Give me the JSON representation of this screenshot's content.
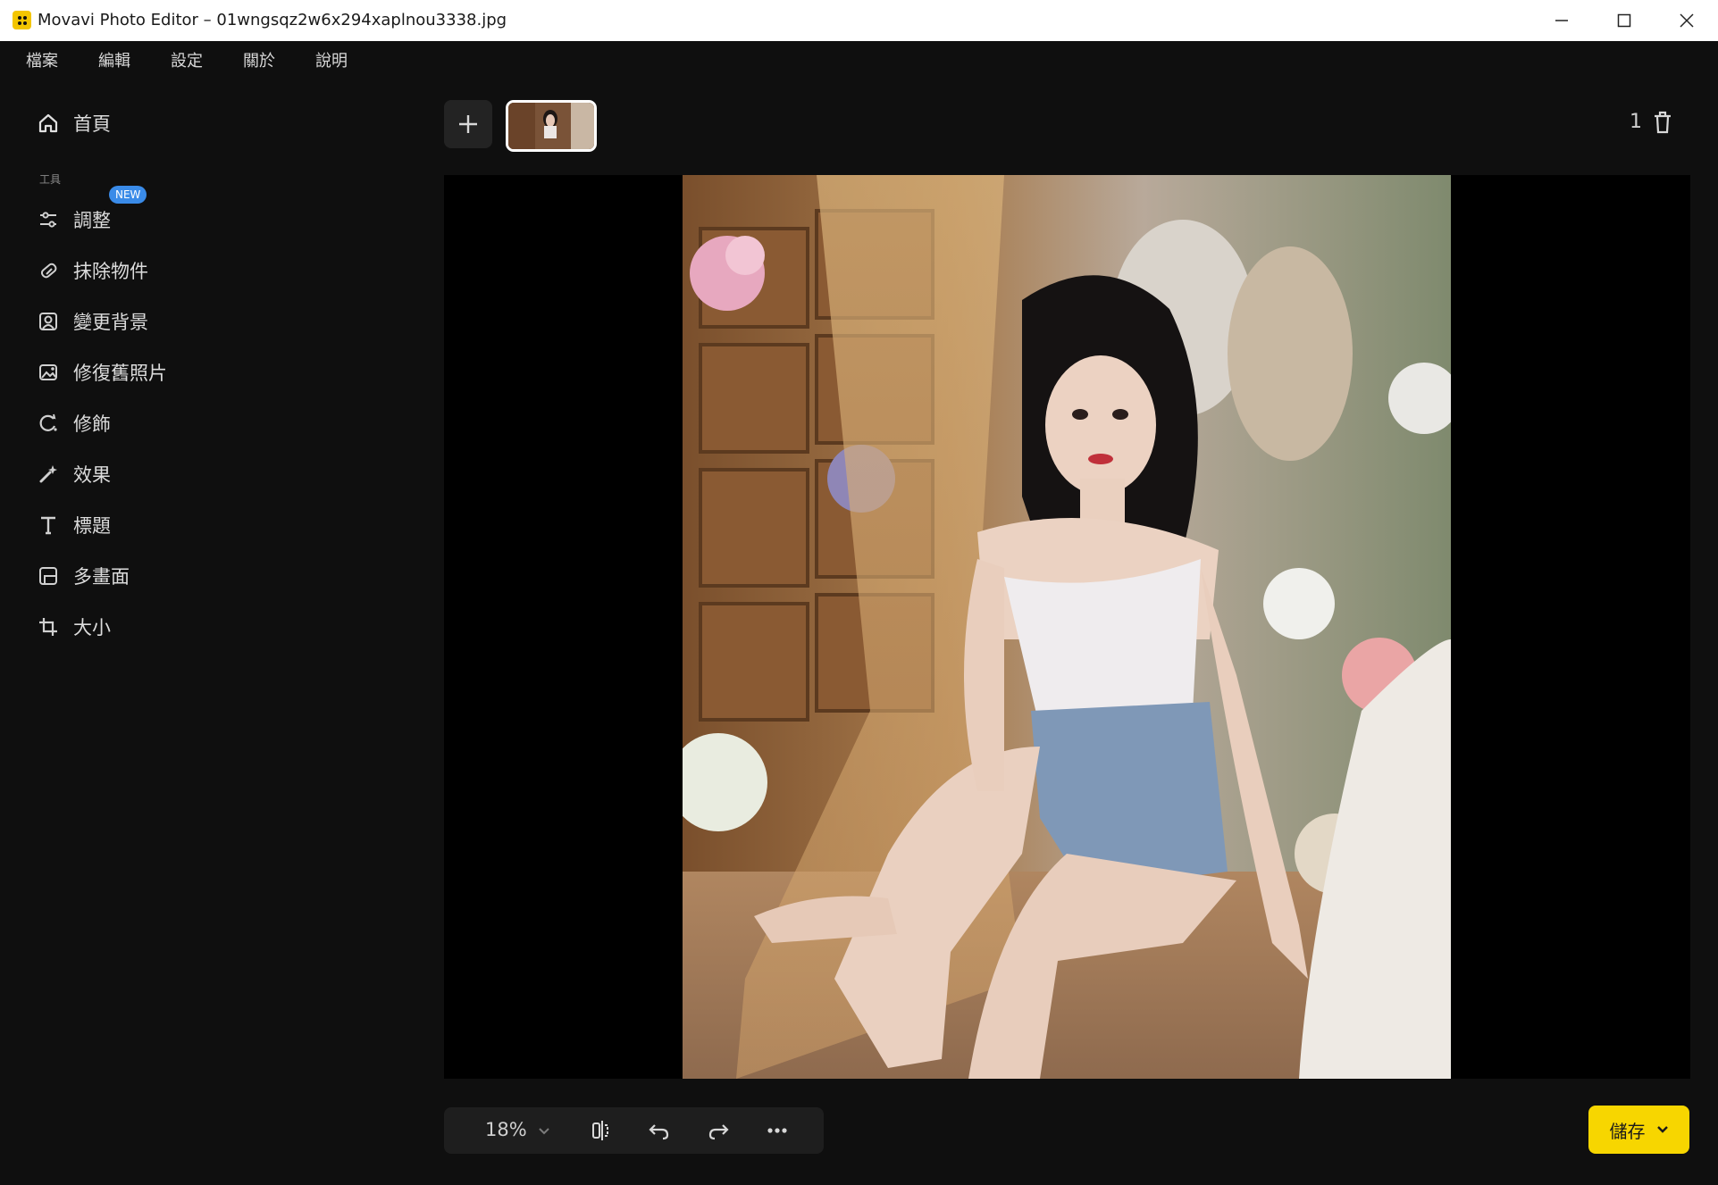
{
  "window": {
    "title": "Movavi Photo Editor – 01wngsqz2w6x294xaplnou3338.jpg"
  },
  "menu": [
    "檔案",
    "編輯",
    "設定",
    "關於",
    "說明"
  ],
  "sidebar": {
    "home_label": "首頁",
    "section_label": "工具",
    "new_badge": "NEW",
    "items": [
      {
        "label": "調整",
        "icon": "sliders-icon"
      },
      {
        "label": "抹除物件",
        "icon": "eraser-icon"
      },
      {
        "label": "變更背景",
        "icon": "portrait-icon"
      },
      {
        "label": "修復舊照片",
        "icon": "restore-photo-icon"
      },
      {
        "label": "修飾",
        "icon": "retouch-icon"
      },
      {
        "label": "效果",
        "icon": "magic-wand-icon"
      },
      {
        "label": "標題",
        "icon": "text-icon"
      },
      {
        "label": "多畫面",
        "icon": "frames-icon"
      },
      {
        "label": "大小",
        "icon": "crop-icon"
      }
    ]
  },
  "strip": {
    "image_count": "1"
  },
  "toolbar": {
    "zoom": "18%"
  },
  "save": {
    "label": "儲存"
  },
  "colors": {
    "accent": "#f7d600",
    "badge": "#3a8be8",
    "background": "#0f0f0f"
  }
}
